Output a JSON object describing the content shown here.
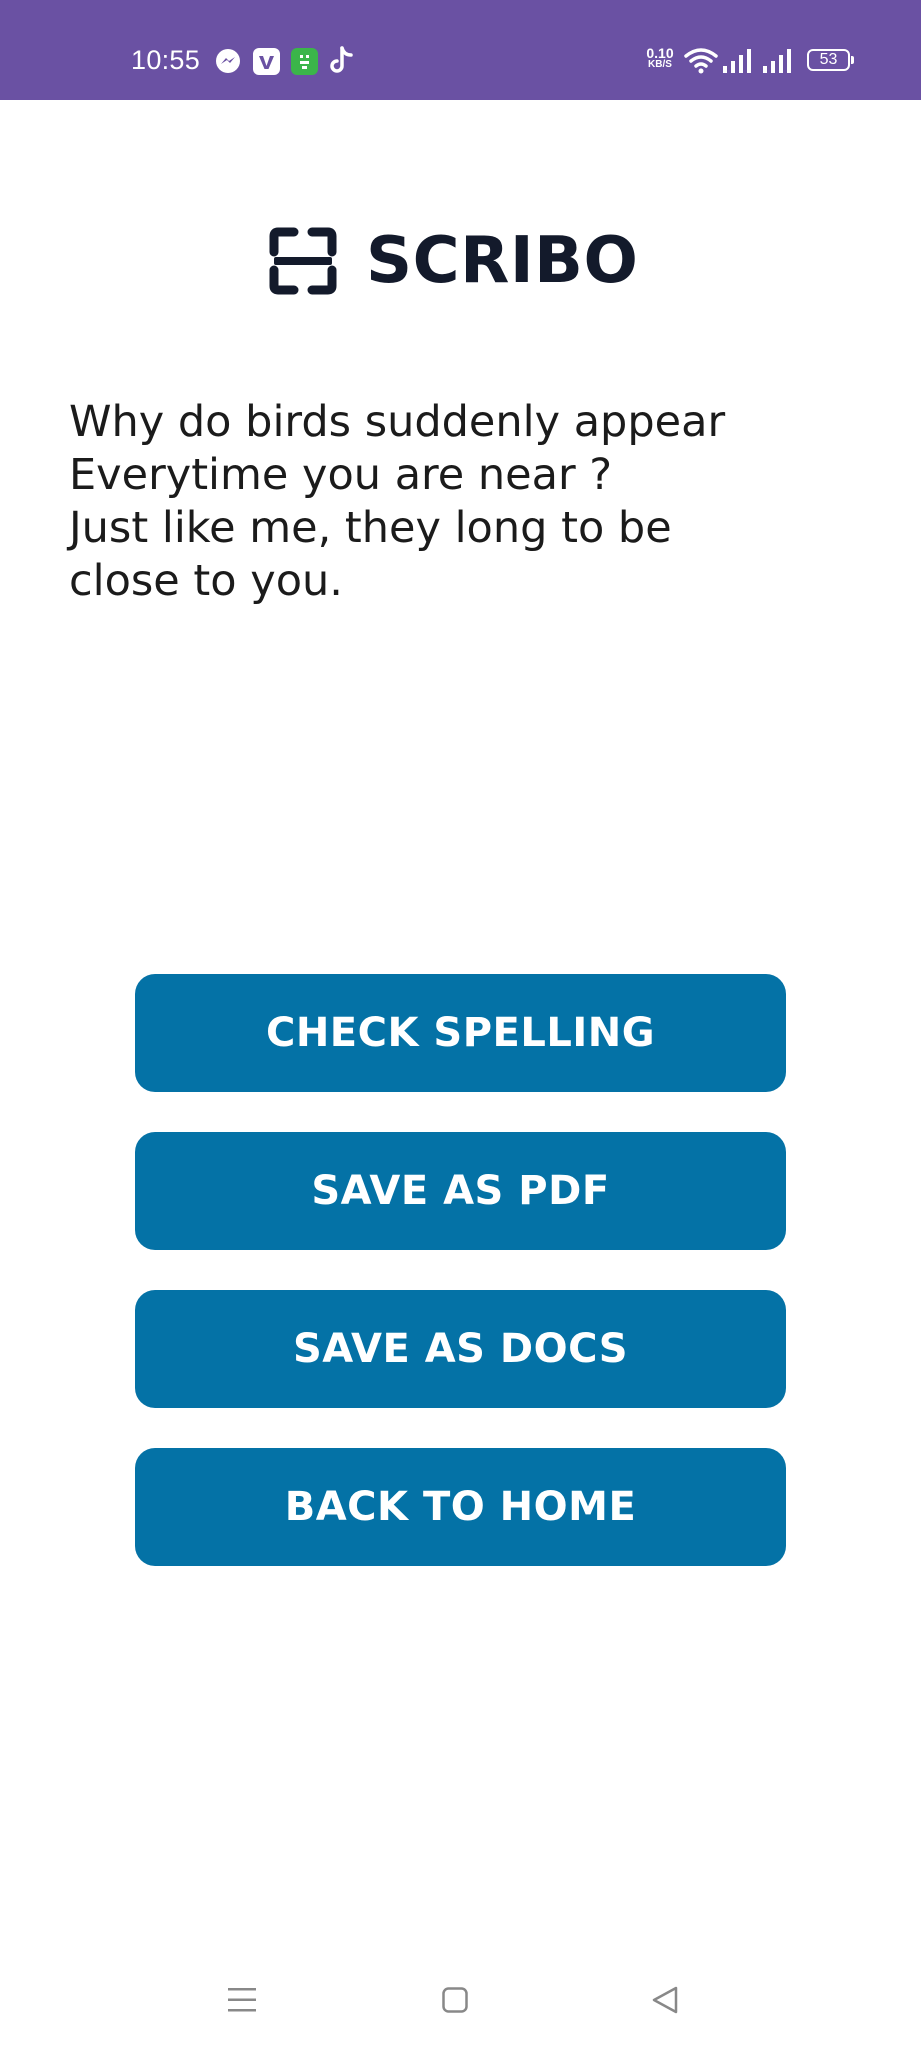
{
  "status_bar": {
    "time": "10:55",
    "app_icons": [
      "messenger-icon",
      "vimeo-icon",
      "chat-app-icon",
      "tiktok-icon"
    ],
    "net_speed_value": "0.10",
    "net_speed_unit": "KB/S",
    "battery_level": "53",
    "background_color": "#6a51a3"
  },
  "header": {
    "logo_icon": "scan-frame-icon",
    "brand_name": "SCRIBO"
  },
  "content": {
    "scanned_text": "Why do birds suddenly appear\nEverytime you are near ?\nJust like me, they long to be\nclose to you."
  },
  "actions": {
    "check_spelling": "CHECK SPELLING",
    "save_pdf": "SAVE AS PDF",
    "save_docs": "SAVE AS DOCS",
    "back_home": "BACK TO HOME",
    "button_color": "#0472a6"
  },
  "nav_bar": {
    "icons": [
      "menu-icon",
      "home-icon",
      "back-icon"
    ]
  }
}
